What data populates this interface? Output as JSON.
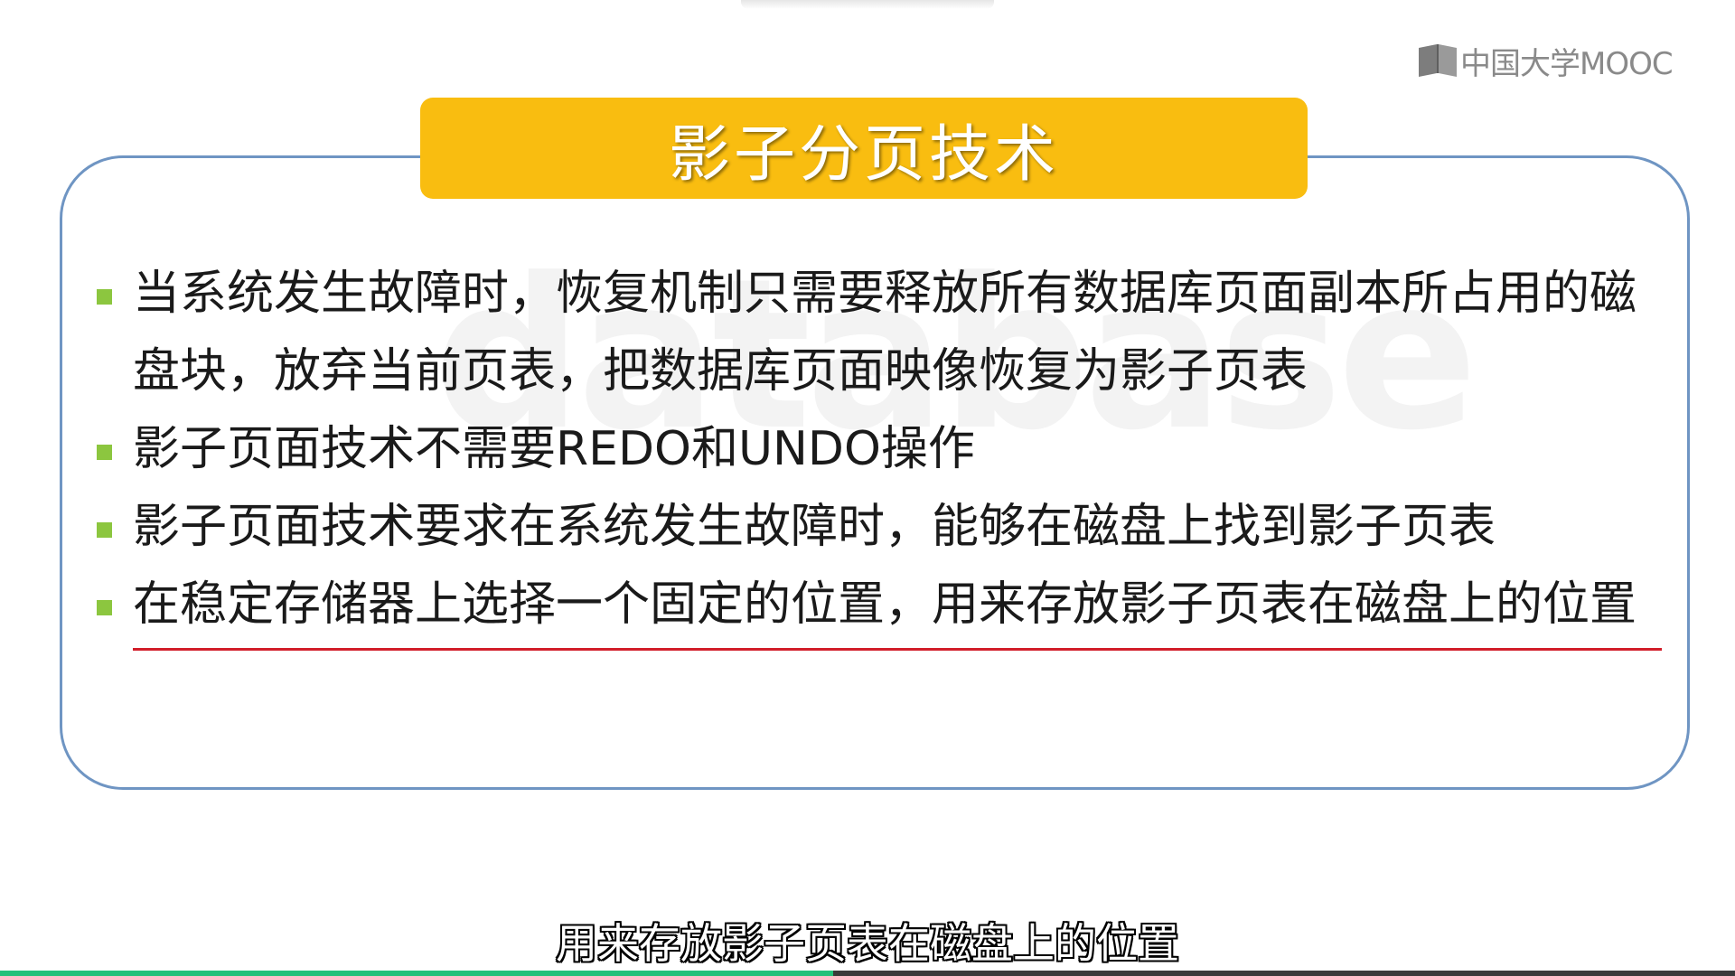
{
  "brand": {
    "logo_text": "中国大学MOOC",
    "logo_icon": "mooc-book-icon"
  },
  "watermark_text": "database",
  "slide": {
    "title": "影子分页技术",
    "bullets": [
      {
        "text": "当系统发生故障时，恢复机制只需要释放所有数据库页面副本所占用的磁盘块，放弃当前页表，把数据库页面映像恢复为影子页表"
      },
      {
        "text": "影子页面技术不需要REDO和UNDO操作"
      },
      {
        "text": "影子页面技术要求在系统发生故障时，能够在磁盘上找到影子页表"
      },
      {
        "text": "在稳定存储器上选择一个固定的位置，用来存放影子页表在磁盘上的位置"
      }
    ]
  },
  "subtitle": "用来存放影子页表在磁盘上的位置",
  "player": {
    "progress_fraction": 0.48
  },
  "colors": {
    "title_bg": "#f9bd10",
    "panel_border": "#6f95c3",
    "bullet_marker": "#8cc63f",
    "underline": "#d21e2a",
    "progress": "#23c17a"
  }
}
